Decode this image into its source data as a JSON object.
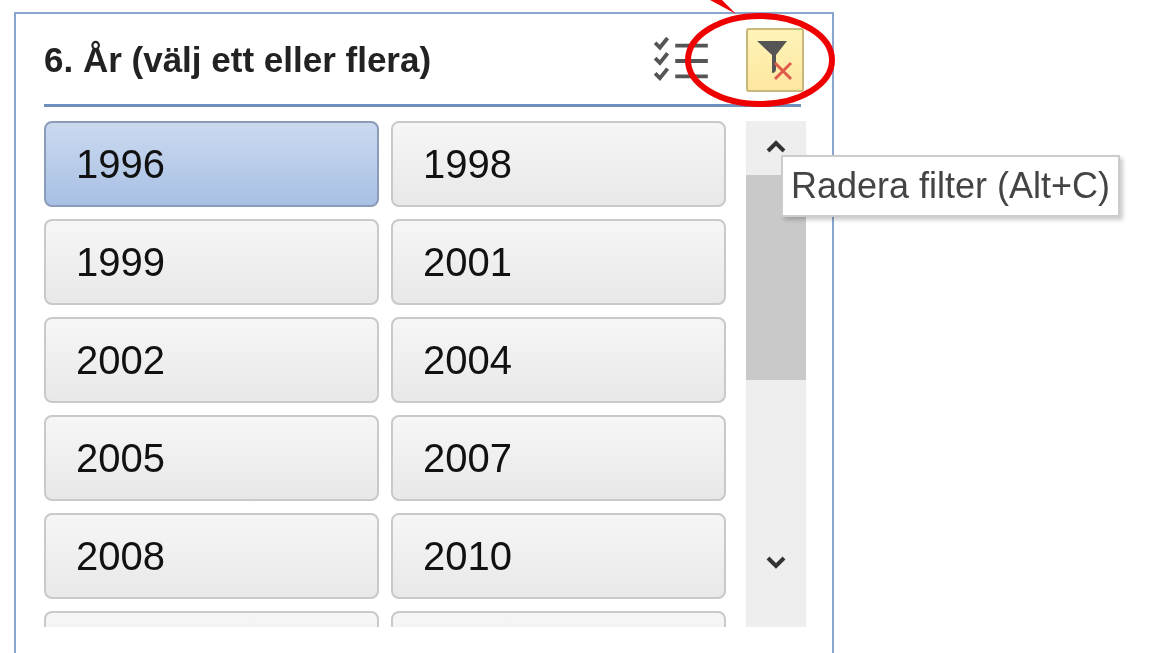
{
  "slicer": {
    "title": "6. År (välj ett eller flera)",
    "items": [
      {
        "label": "1996",
        "selected": true
      },
      {
        "label": "1998",
        "selected": false
      },
      {
        "label": "1999",
        "selected": false
      },
      {
        "label": "2001",
        "selected": false
      },
      {
        "label": "2002",
        "selected": false
      },
      {
        "label": "2004",
        "selected": false
      },
      {
        "label": "2005",
        "selected": false
      },
      {
        "label": "2007",
        "selected": false
      },
      {
        "label": "2008",
        "selected": false
      },
      {
        "label": "2010",
        "selected": false
      }
    ],
    "tooltip": "Radera filter (Alt+C)"
  }
}
